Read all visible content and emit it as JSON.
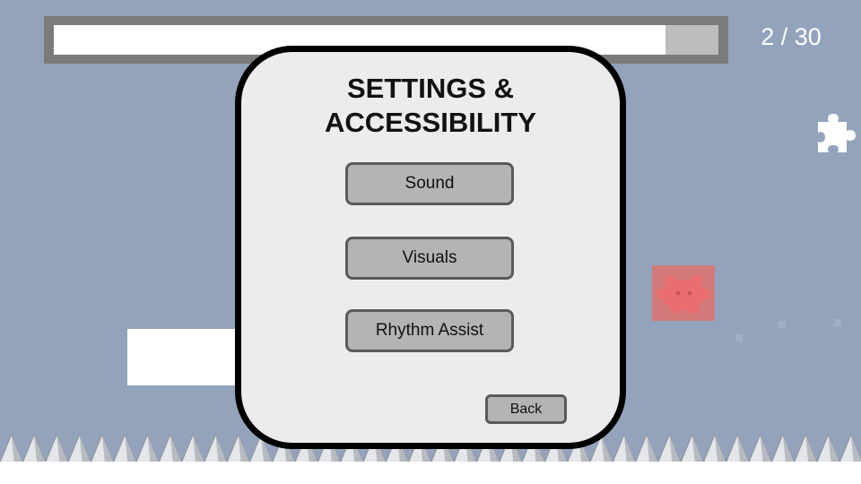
{
  "hud": {
    "progress_fraction": 0.92,
    "level_counter": "2 / 30"
  },
  "icons": {
    "puzzle": "puzzle-piece-icon",
    "enemy": "red-creature-icon"
  },
  "modal": {
    "title_line1": "SETTINGS &",
    "title_line2": "ACCESSIBILITY",
    "buttons": {
      "sound": "Sound",
      "visuals": "Visuals",
      "rhythm_assist": "Rhythm Assist"
    },
    "back": "Back"
  },
  "colors": {
    "background": "#93a3bb",
    "modal_bg": "#ececee",
    "button_bg": "#b4b4b4",
    "enemy": "#d87878"
  }
}
